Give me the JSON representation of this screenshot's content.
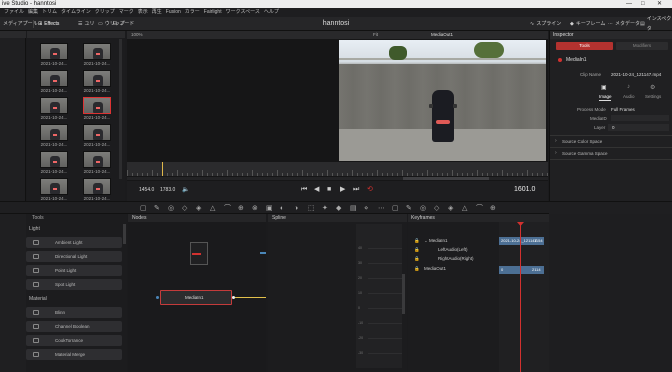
{
  "window": {
    "title": "ive Studio - hanntosi",
    "project_name": "hanntosi"
  },
  "menu": [
    "ファイル",
    "編集",
    "トリム",
    "タイムライン",
    "クリップ",
    "マーク",
    "表示",
    "再生",
    "Fusion",
    "カラー",
    "Fairlight",
    "ワークスペース",
    "ヘルプ"
  ],
  "toolbar": {
    "media_pool": "メディアプール",
    "effects": "Effects",
    "edit_index": "ユリ",
    "clips": "ウリップ",
    "nodes": "ノード",
    "spline": "スプライン",
    "keyframes": "キーフレーム",
    "metadata": "メタデータ",
    "inspector": "インスペクタ"
  },
  "media": {
    "thumbs": [
      {
        "label": "2021-10-24...",
        "selected": false
      },
      {
        "label": "2021-10-24...",
        "selected": false
      },
      {
        "label": "2021-10-24...",
        "selected": false
      },
      {
        "label": "2021-10-24...",
        "selected": false
      },
      {
        "label": "2021-10-24...",
        "selected": false
      },
      {
        "label": "2021-10-24...",
        "selected": true
      },
      {
        "label": "2021-10-24...",
        "selected": false
      },
      {
        "label": "2021-10-24...",
        "selected": false
      },
      {
        "label": "2021-10-24...",
        "selected": false
      },
      {
        "label": "2021-10-24...",
        "selected": false
      },
      {
        "label": "2021-10-24...",
        "selected": false
      },
      {
        "label": "2021-10-24...",
        "selected": false
      }
    ]
  },
  "viewer": {
    "title": "MediaOut1",
    "zoom": "100%",
    "fit": "Fit",
    "start_frame": "1454.0",
    "end_frame": "1783.0",
    "current_frame": "1601.0"
  },
  "effects": {
    "title": "Tools",
    "sections": [
      {
        "label": "Light",
        "items": [
          "Ambient Light",
          "Directional Light",
          "Point Light",
          "Spot Light"
        ]
      },
      {
        "label": "Material",
        "items": [
          "Blinn",
          "Channel Boolean",
          "CookTorrance",
          "Material Merge"
        ]
      }
    ]
  },
  "nodes": {
    "title": "Nodes",
    "node_label": "MediaIn1"
  },
  "spline": {
    "title": "Spline",
    "values": [
      "40",
      "30",
      "20",
      "10",
      "0",
      "-10",
      "-20",
      "-30"
    ]
  },
  "keyframes": {
    "title": "Keyframes",
    "rows": [
      {
        "label": "MediaIn1",
        "indent": 0
      },
      {
        "label": "LeftAudio(Left)",
        "indent": 1
      },
      {
        "label": "RightAudio(Right)",
        "indent": 1
      },
      {
        "label": "MediaOut1",
        "indent": 0
      }
    ],
    "clip_bar_label": "2021-10-24_121147",
    "clip_bar_value": "1154",
    "out_bar_value": "2114",
    "out_bar_start": "0"
  },
  "inspector": {
    "title": "Inspector",
    "tools_tab": "Tools",
    "modifiers_tab": "Modifiers",
    "node_name": "MediaIn1",
    "clip_name_label": "Clip Name",
    "clip_name": "2021-10-24_121147.mp4",
    "tabs": [
      "Image",
      "Audio",
      "Settings"
    ],
    "process_mode_label": "Process Mode",
    "process_mode": "Full Frames",
    "media_id_label": "MediaID",
    "layer_label": "Layer",
    "layer": "0",
    "source_color_space": "Source Color Space",
    "source_gamma_space": "Source Gamma Space"
  },
  "colors": {
    "accent_red": "#d2312f",
    "bg": "#1b1b1d",
    "panel": "#232325"
  }
}
